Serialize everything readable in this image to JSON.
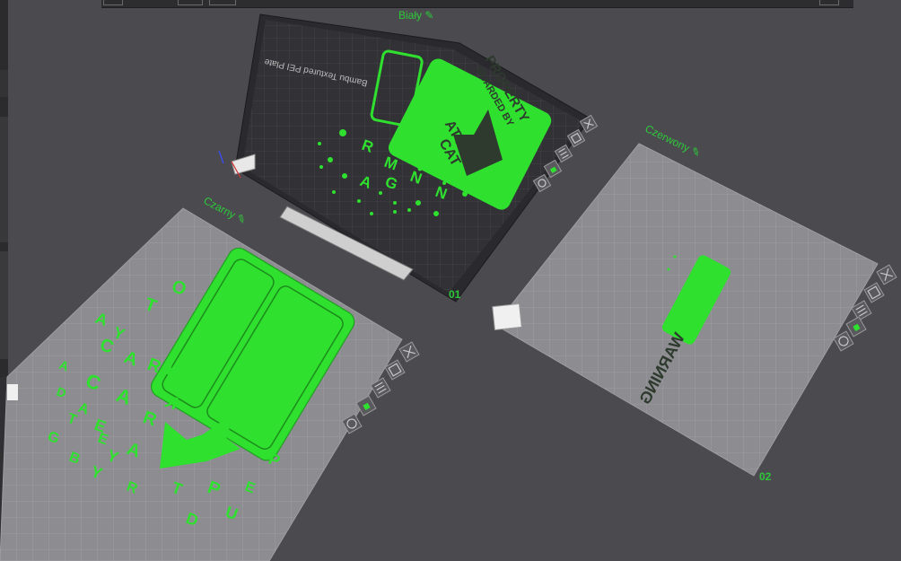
{
  "colors": {
    "background": "#4b4b4f",
    "plate_light": "#8a8a8f",
    "plate_dark": "#2f2f33",
    "print_green": "#2fe02f",
    "label_green": "#2ec93a"
  },
  "plates": {
    "top": {
      "filament_label": "Biały ✎",
      "number": "01",
      "bed_text": "Bambu Textured PEI Plate",
      "sign_line1": "PROPERTY",
      "sign_line2": "GUARDED BY",
      "sign_line3": "ATTACK",
      "sign_line4": "CAT",
      "letters": [
        "R",
        "M",
        "N",
        "A",
        "G",
        "N"
      ]
    },
    "left": {
      "filament_label": "Czarny ✎",
      "letters": [
        "O",
        "T",
        "A",
        "Y",
        "C",
        "A",
        "R",
        "K",
        "A",
        "C",
        "A",
        "K",
        "D",
        "A",
        "E",
        "R",
        "T",
        "E",
        "Y",
        "A",
        "G",
        "B",
        "Y",
        "R",
        "T",
        "P",
        "E",
        "U",
        "D",
        "P"
      ]
    },
    "right": {
      "filament_label": "Czerwony ✎",
      "number": "02",
      "sign_text": "WARNING"
    }
  },
  "plate_controls": [
    "orient-icon",
    "lock-icon",
    "slice-icon",
    "arrange-icon",
    "close-icon"
  ]
}
